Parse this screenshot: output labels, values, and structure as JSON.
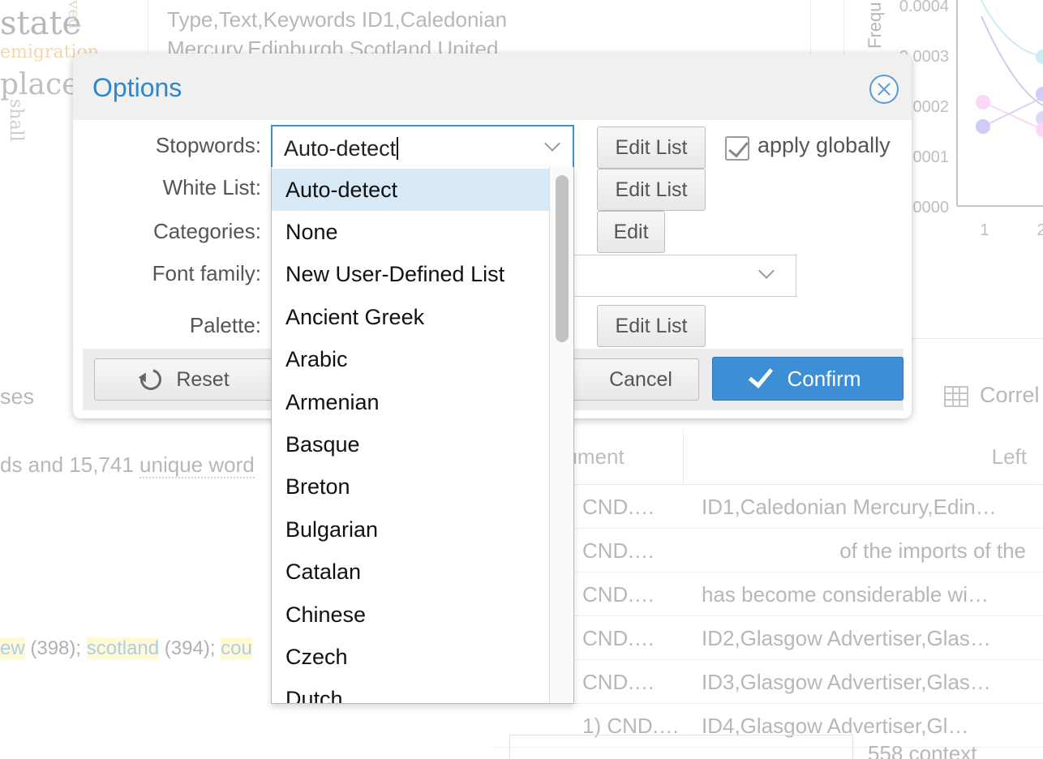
{
  "background": {
    "cloud_words": [
      "state",
      "emigration",
      "place",
      "shall",
      "ved"
    ],
    "reader_lines": [
      "Type,Text,Keywords ID1,Caledonian",
      "Mercury,Edinburgh,Scotland,United"
    ],
    "summary": {
      "part1": "ds and 15,741 ",
      "unique_words": "unique word",
      "keywords": [
        {
          "word": "ew",
          "count": "(398);"
        },
        {
          "word": "scotland",
          "count": "(394);"
        },
        {
          "word": "cou",
          "count": ""
        }
      ]
    },
    "tabs": {
      "left_partial": "ses",
      "correlations_partial": "Correl"
    },
    "contexts": {
      "headers": {
        "document": "ocument",
        "left": "Left"
      },
      "rows": [
        {
          "doc": "CND.…",
          "left": "ID1,Caledonian Mercury,Edin…",
          "align": "left"
        },
        {
          "doc": "CND.…",
          "left": "of the imports of the",
          "align": "right"
        },
        {
          "doc": "CND.…",
          "left": "has become considerable wi…",
          "align": "left"
        },
        {
          "doc": "CND.…",
          "left": "ID2,Glasgow Advertiser,Glas…",
          "align": "left"
        },
        {
          "doc": "CND.…",
          "left": "ID3,Glasgow Advertiser,Glas…",
          "align": "left"
        },
        {
          "doc": "1) CND.…",
          "left": "ID4,Glasgow Advertiser,Gl…",
          "align": "left"
        }
      ],
      "footer_text": "558  context"
    },
    "chart": {
      "ylabel": "Frequ",
      "y_ticks": [
        "0.0004",
        "0.0003",
        "0002",
        "0001",
        "0000"
      ],
      "x_ticks": [
        "1",
        "2"
      ]
    }
  },
  "dialog": {
    "title": "Options",
    "labels": {
      "stopwords": "Stopwords:",
      "white_list": "White List:",
      "categories": "Categories:",
      "font_family": "Font family:",
      "palette": "Palette:"
    },
    "stopwords_value": "Auto-detect",
    "buttons": {
      "edit_list": "Edit List",
      "edit": "Edit",
      "reset": "Reset",
      "cancel": "Cancel",
      "confirm": "Confirm"
    },
    "apply_globally": "apply globally",
    "apply_globally_checked": true
  },
  "dropdown": {
    "selected": "Auto-detect",
    "options": [
      "Auto-detect",
      "None",
      "New User-Defined List",
      "Ancient Greek",
      "Arabic",
      "Armenian",
      "Basque",
      "Breton",
      "Bulgarian",
      "Catalan",
      "Chinese",
      "Czech",
      "Dutch"
    ]
  },
  "colors": {
    "accent": "#3c8fd4",
    "title": "#2f86c9",
    "selected_option": "#d7e8f7",
    "keyword_highlight": "#fff59a"
  }
}
